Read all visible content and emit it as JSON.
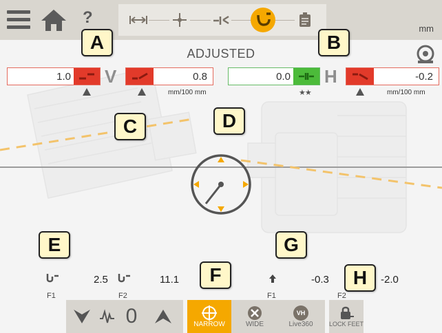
{
  "header": {
    "unit": "mm",
    "help_label": "?",
    "steps": [
      "dimensions-icon",
      "measure-icon",
      "results-icon",
      "adjust-icon",
      "report-icon"
    ],
    "active_step": 3
  },
  "title": "ADJUSTED",
  "vertical": {
    "letter": "V",
    "offset_value": "1.0",
    "angle_value": "0.8",
    "unit": "mm/100 mm"
  },
  "horizontal": {
    "letter": "H",
    "offset_value": "0.0",
    "angle_value": "-0.2",
    "unit": "mm/100 mm",
    "quality": "★★"
  },
  "callouts": [
    "A",
    "B",
    "C",
    "D",
    "E",
    "F",
    "G",
    "H"
  ],
  "feet": {
    "f1_value": "2.5",
    "f2_value": "11.1",
    "f1_label": "F1",
    "f2_label": "F2",
    "g_value": "-0.3",
    "g_f2_value": "-2.0",
    "g_f1_label": "F1",
    "g_f2_label": "F2"
  },
  "toolbar": {
    "zero_label": "0",
    "narrow_label": "NARROW",
    "wide_label": "WIDE",
    "live360_label": "Live360",
    "lockfeet_label": "LOCK FEET",
    "vh_icon_text": "VH"
  },
  "colors": {
    "accent": "#f5a800",
    "alarm_red": "#e23a2a",
    "ok_green": "#4cbb3a"
  }
}
